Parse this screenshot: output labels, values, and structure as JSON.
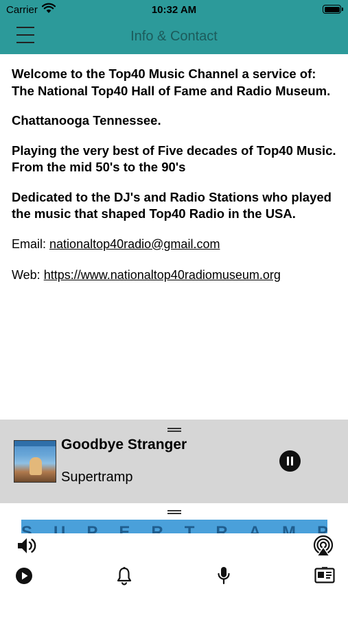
{
  "status_bar": {
    "carrier": "Carrier",
    "time": "10:32 AM"
  },
  "nav": {
    "title": "Info & Contact",
    "menu_icon": "hamburger-menu-icon"
  },
  "content": {
    "paragraphs": [
      "Welcome to the Top40 Music Channel a service of:",
      "The National Top40 Hall of Fame and Radio Museum.",
      "Chattanooga Tennessee.",
      "Playing the very best of Five decades of Top40 Music. From the mid 50's to the 90's",
      "Dedicated to the DJ's and Radio Stations who played the music that shaped Top40 Radio in the USA."
    ],
    "email_label": "Email:",
    "email": "nationaltop40radio@gmail.com",
    "web_label": "Web:",
    "web": "https://www.nationaltop40radiomuseum.org"
  },
  "player": {
    "song": "Goodbye Stranger",
    "artist": "Supertramp",
    "marquee": "SUPERTRAMP"
  },
  "toolbar": {
    "icons": [
      "volume-icon",
      "airplay-icon",
      "play-icon",
      "bell-icon",
      "microphone-icon",
      "contact-card-icon"
    ]
  },
  "colors": {
    "nav_bg": "#2c9a9a",
    "nav_title": "#1c5b5b",
    "player_bg": "#d6d6d6"
  }
}
